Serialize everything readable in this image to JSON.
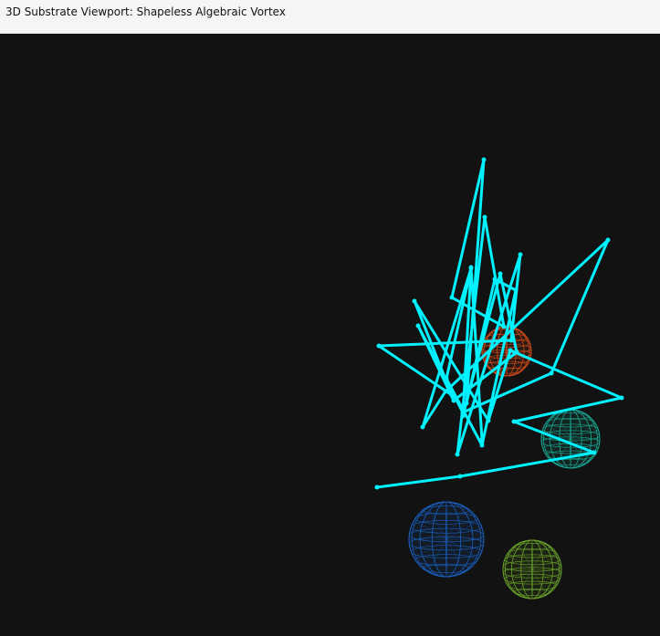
{
  "window": {
    "title": "3D Substrate Viewport: Shapeless Algebraic Vortex"
  },
  "viewport": {
    "background": "#121212",
    "vortex": {
      "color": "#00f2ff"
    },
    "spheres": [
      {
        "name": "orange-wireframe-sphere",
        "color": "#cf4b1b"
      },
      {
        "name": "teal-wireframe-sphere",
        "color": "#1aa58f"
      },
      {
        "name": "blue-wireframe-sphere",
        "color": "#1b5fc0"
      },
      {
        "name": "green-wireframe-sphere",
        "color": "#6aa12a"
      }
    ]
  }
}
